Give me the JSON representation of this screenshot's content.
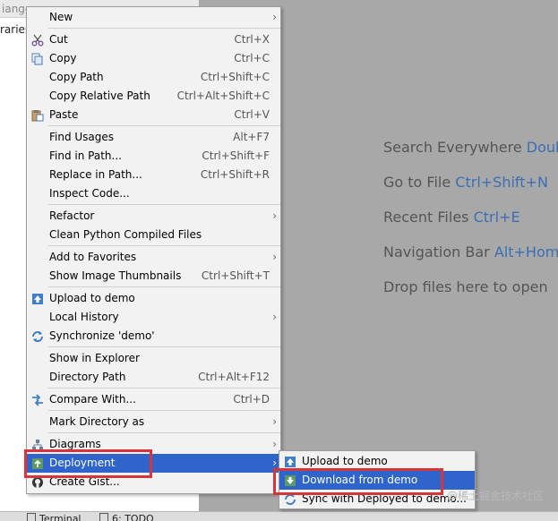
{
  "project_panel": {
    "title": "iango",
    "item": "raries"
  },
  "editor_hints": [
    {
      "text": "Search Everywhere",
      "key": "Doubl"
    },
    {
      "text": "Go to File",
      "key": "Ctrl+Shift+N"
    },
    {
      "text": "Recent Files",
      "key": "Ctrl+E"
    },
    {
      "text": "Navigation Bar",
      "key": "Alt+Home"
    },
    {
      "text": "Drop files here to open",
      "key": ""
    }
  ],
  "bottom_bar": {
    "terminal": "Terminal",
    "todo": "6: TODO"
  },
  "context_menu": {
    "new": "New",
    "cut": {
      "label": "Cut",
      "shortcut": "Ctrl+X"
    },
    "copy": {
      "label": "Copy",
      "shortcut": "Ctrl+C"
    },
    "copy_path": {
      "label": "Copy Path",
      "shortcut": "Ctrl+Shift+C"
    },
    "copy_relative_path": {
      "label": "Copy Relative Path",
      "shortcut": "Ctrl+Alt+Shift+C"
    },
    "paste": {
      "label": "Paste",
      "shortcut": "Ctrl+V"
    },
    "find_usages": {
      "label": "Find Usages",
      "shortcut": "Alt+F7"
    },
    "find_in_path": {
      "label": "Find in Path...",
      "shortcut": "Ctrl+Shift+F"
    },
    "replace_in_path": {
      "label": "Replace in Path...",
      "shortcut": "Ctrl+Shift+R"
    },
    "inspect_code": {
      "label": "Inspect Code..."
    },
    "refactor": {
      "label": "Refactor"
    },
    "clean_python": {
      "label": "Clean Python Compiled Files"
    },
    "add_to_favorites": {
      "label": "Add to Favorites"
    },
    "show_image_thumbnails": {
      "label": "Show Image Thumbnails",
      "shortcut": "Ctrl+Shift+T"
    },
    "upload_to_demo": {
      "label": "Upload to demo"
    },
    "local_history": {
      "label": "Local History"
    },
    "synchronize": {
      "label": "Synchronize 'demo'"
    },
    "show_in_explorer": {
      "label": "Show in Explorer"
    },
    "directory_path": {
      "label": "Directory Path",
      "shortcut": "Ctrl+Alt+F12"
    },
    "compare_with": {
      "label": "Compare With...",
      "shortcut": "Ctrl+D"
    },
    "mark_directory_as": {
      "label": "Mark Directory as"
    },
    "diagrams": {
      "label": "Diagrams"
    },
    "deployment": {
      "label": "Deployment"
    },
    "create_gist": {
      "label": "Create Gist..."
    }
  },
  "deployment_submenu": {
    "upload": "Upload to demo",
    "download": "Download from demo",
    "sync": "Sync with Deployed to demo..."
  },
  "watermark": "@稀土掘金技术社区",
  "colors": {
    "selection": "#2f65ca",
    "highlight_box": "#d8343a",
    "shortcut_key": "#3b6fb4"
  }
}
